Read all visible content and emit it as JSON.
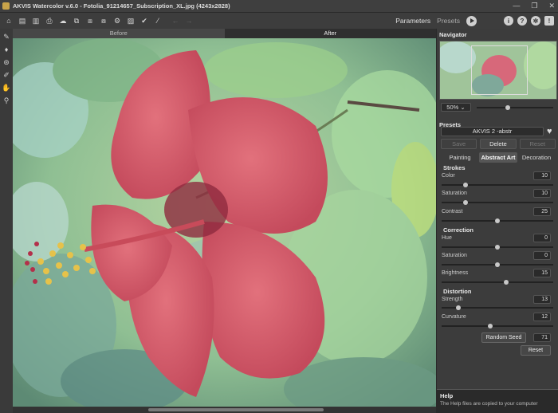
{
  "window": {
    "title": "AKVIS Watercolor v.6.0 - Fotolia_91214657_Subscription_XL.jpg (4243x2828)",
    "controls": [
      "—",
      "❐",
      "✕"
    ]
  },
  "toolbar": {
    "tab_parameters": "Parameters",
    "tab_presets": "Presets"
  },
  "view": {
    "before_label": "Before",
    "after_label": "After"
  },
  "navigator": {
    "title": "Navigator",
    "zoom": "50% ⌄"
  },
  "presets": {
    "title": "Presets",
    "selected": "AKVIS 2 -abstr",
    "save_label": "Save",
    "delete_label": "Delete",
    "reset_label": "Reset"
  },
  "tabs": [
    "Painting",
    "Abstract Art",
    "Decoration"
  ],
  "strokes": {
    "title": "Strokes",
    "color_label": "Color",
    "color_value": "10",
    "saturation_label": "Saturation",
    "saturation_value": "10",
    "contrast_label": "Contrast",
    "contrast_value": "25"
  },
  "correction": {
    "title": "Correction",
    "hue_label": "Hue",
    "hue_value": "0",
    "saturation_label": "Saturation",
    "saturation_value": "0",
    "brightness_label": "Brightness",
    "brightness_value": "15"
  },
  "distortion": {
    "title": "Distortion",
    "strength_label": "Strength",
    "strength_value": "13",
    "curvature_label": "Curvature",
    "curvature_value": "12"
  },
  "random_seed": {
    "label": "Random Seed",
    "value": "71"
  },
  "reset_button": "Reset",
  "help": {
    "title": "Help",
    "text": "The Help files are copied to your computer"
  },
  "accent_color": "#d8d8d8"
}
